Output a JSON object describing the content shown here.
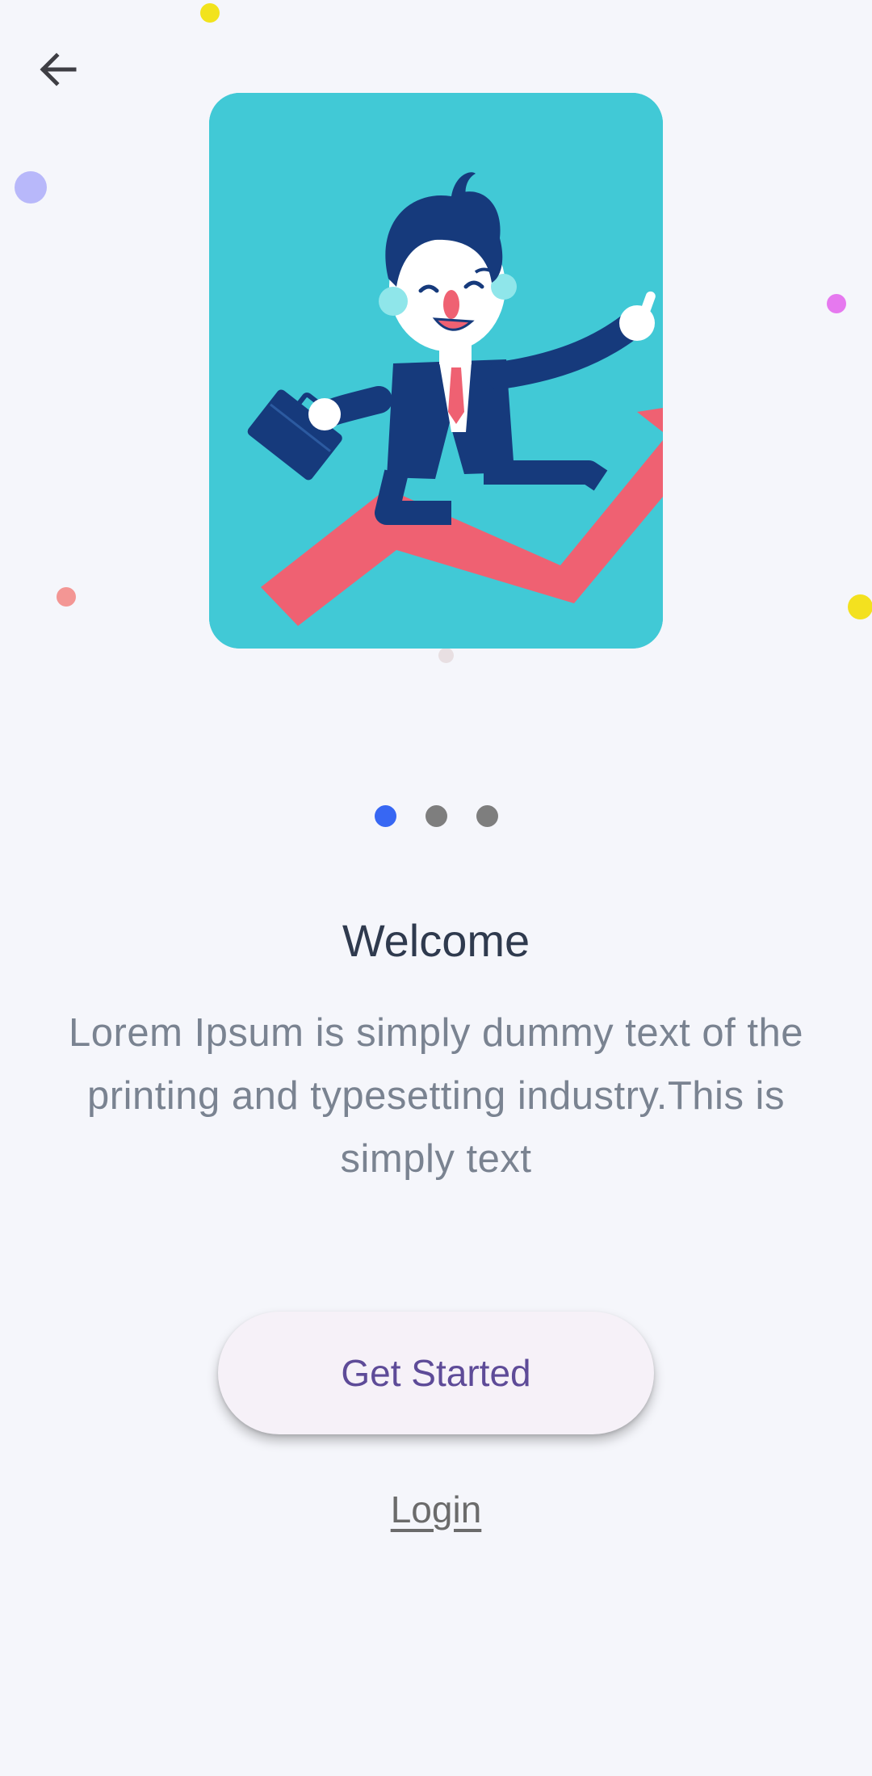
{
  "onboarding": {
    "title": "Welcome",
    "description": "Lorem Ipsum is simply dummy text of the printing and typesetting industry.This is simply text",
    "primary_button": "Get Started",
    "secondary_link": "Login",
    "pagination": {
      "total": 3,
      "active_index": 0
    }
  },
  "icons": {
    "back": "arrow-left-icon",
    "illustration": "businessman-growth-chart"
  },
  "colors": {
    "background": "#f5f6fb",
    "accent_dot": "#3767f3",
    "inactive_dot": "#7e7e7e",
    "button_bg": "#f6f1f8",
    "button_text": "#5e4b98",
    "title_text": "#2f3a4e",
    "body_text": "#7a8391",
    "illustration_bg": "#41c9d6"
  }
}
